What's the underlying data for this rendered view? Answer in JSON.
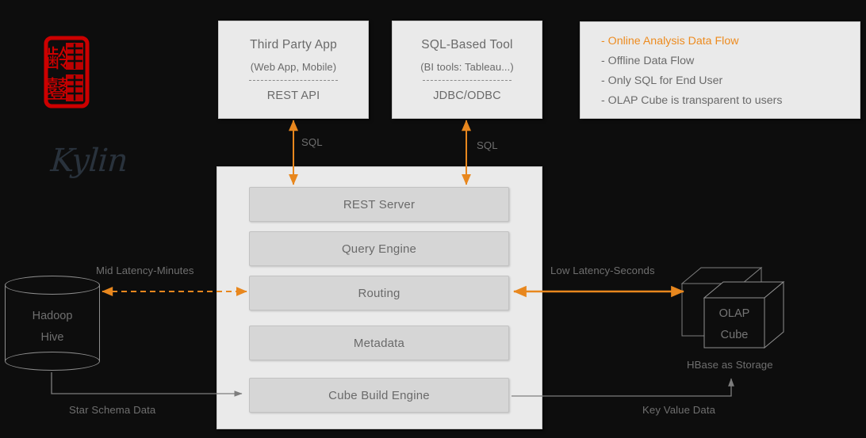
{
  "brand": {
    "seal_characters": "麒麟",
    "wordmark": "Kylin",
    "seal_color": "#cc0000"
  },
  "clients": [
    {
      "title": "Third Party App",
      "subtitle": "(Web App, Mobile)",
      "protocol": "REST API"
    },
    {
      "title": "SQL-Based Tool",
      "subtitle": "(BI tools: Tableau...)",
      "protocol": "JDBC/ODBC"
    }
  ],
  "legend": {
    "items": [
      {
        "text": "- Online Analysis Data Flow",
        "accent": true
      },
      {
        "text": "- Offline Data Flow",
        "accent": false
      },
      {
        "text": "- Only SQL for End User",
        "accent": false
      },
      {
        "text": "- OLAP Cube is transparent to users",
        "accent": false
      }
    ],
    "accent_color": "#ed8b1f",
    "text_color": "#6a6a6a"
  },
  "core": {
    "rows": [
      "REST Server",
      "Query Engine",
      "Routing",
      "Metadata",
      "Cube Build Engine"
    ]
  },
  "storage": {
    "hadoop": {
      "line1": "Hadoop",
      "line2": "Hive"
    },
    "olap": {
      "line1": "OLAP",
      "line2": "Cube"
    },
    "hbase_caption": "HBase as Storage"
  },
  "edges": {
    "sql_left": "SQL",
    "sql_right": "SQL",
    "mid_latency": "Mid Latency-Minutes",
    "low_latency": "Low Latency-Seconds",
    "star_schema": "Star Schema Data",
    "key_value": "Key Value Data"
  },
  "colors": {
    "background": "#0d0d0d",
    "panel": "#eaeaea",
    "inner_box": "#d6d6d6",
    "orange": "#e8871e",
    "gray_line": "#8e8e8e",
    "text": "#6a6a6a"
  }
}
